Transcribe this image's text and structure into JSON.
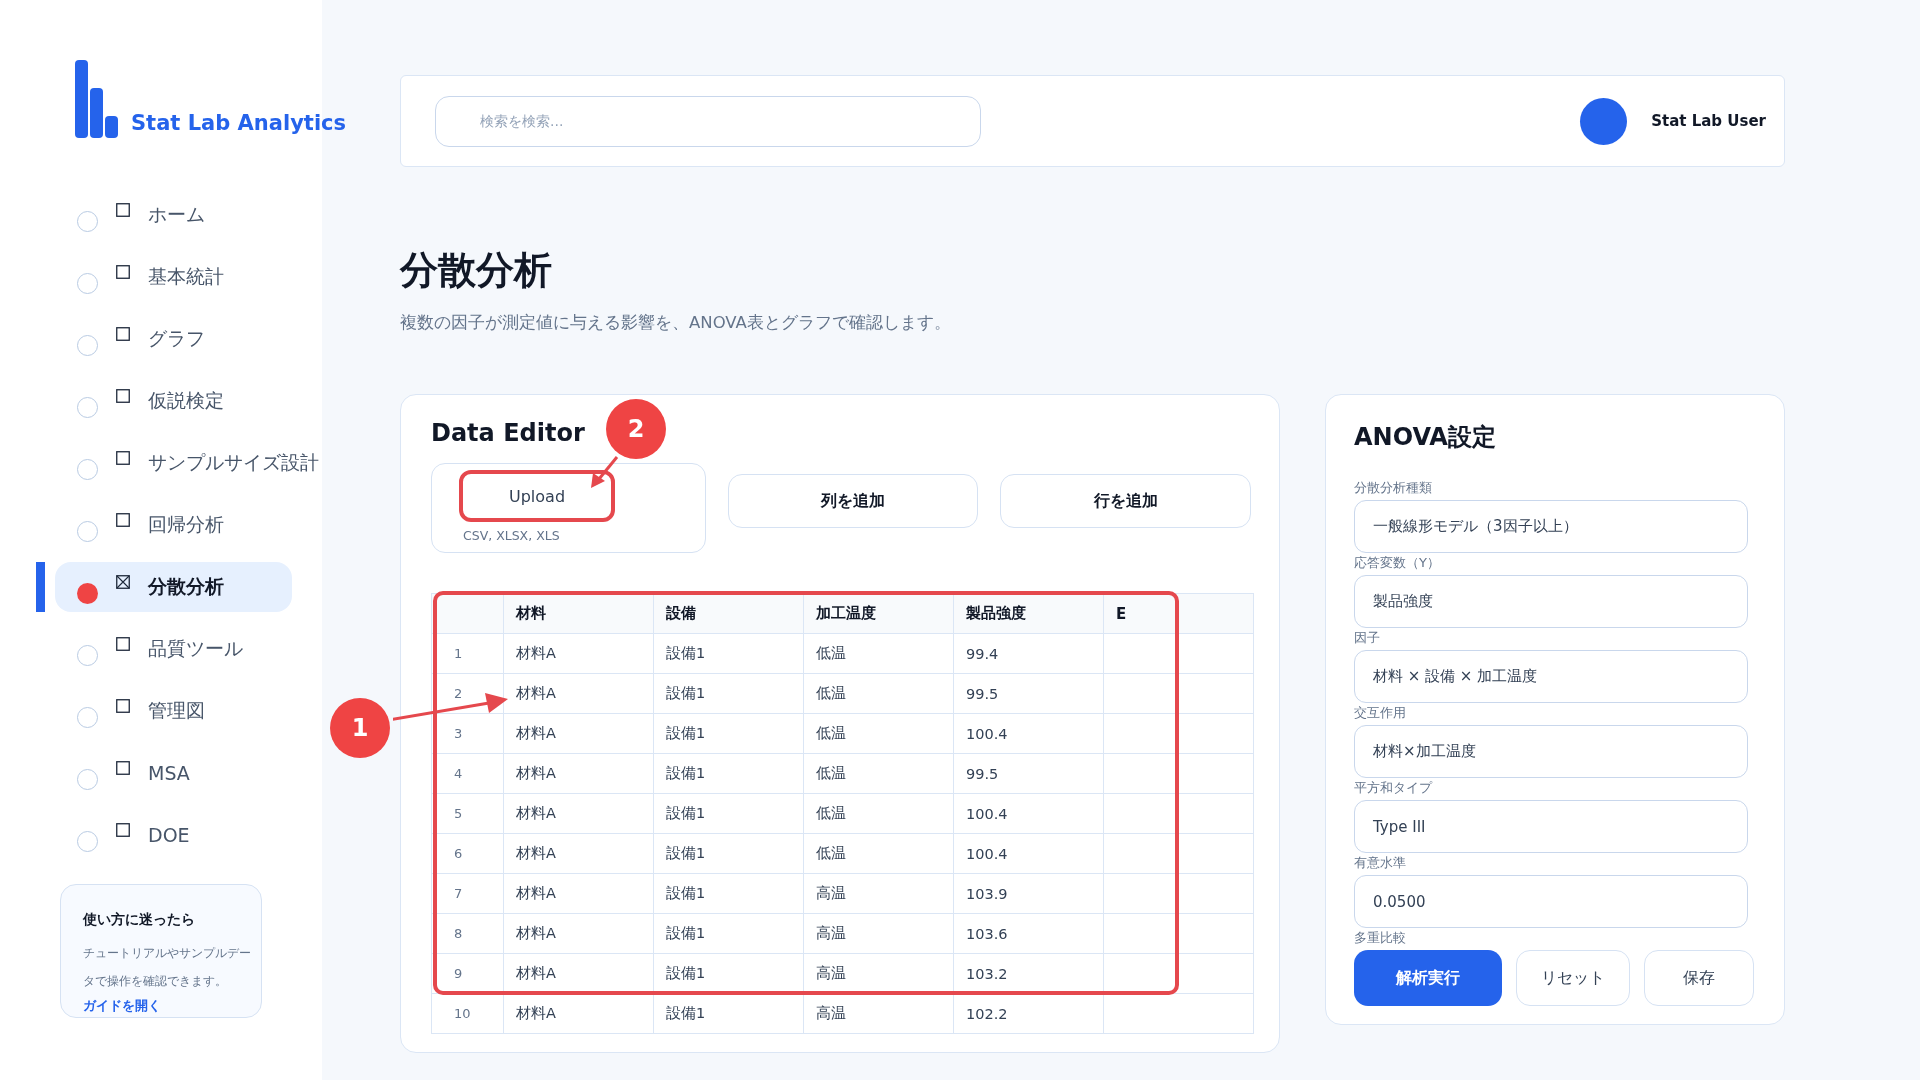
{
  "brand": {
    "name": "Stat Lab Analytics"
  },
  "sidebar": {
    "items": [
      {
        "label": "ホーム",
        "selected": false
      },
      {
        "label": "基本統計",
        "selected": false
      },
      {
        "label": "グラフ",
        "selected": false
      },
      {
        "label": "仮説検定",
        "selected": false
      },
      {
        "label": "サンプルサイズ設計",
        "selected": false
      },
      {
        "label": "回帰分析",
        "selected": false
      },
      {
        "label": "分散分析",
        "selected": true
      },
      {
        "label": "品質ツール",
        "selected": false
      },
      {
        "label": "管理図",
        "selected": false
      },
      {
        "label": "MSA",
        "selected": false
      },
      {
        "label": "DOE",
        "selected": false
      }
    ],
    "help": {
      "title": "使い方に迷ったら",
      "text": "チュートリアルやサンプルデータで操作を確認できます。",
      "link": "ガイドを開く"
    }
  },
  "header": {
    "search": {
      "placeholder": "検索を検索..."
    },
    "user": "Stat Lab User"
  },
  "page": {
    "title": "分散分析",
    "subtitle": "複数の因子が測定値に与える影響を、ANOVA表とグラフで確認します。"
  },
  "data_editor": {
    "title": "Data Editor",
    "upload": {
      "label": "Upload",
      "formats": "CSV, XLSX, XLS"
    },
    "buttons": [
      "列を追加",
      "行を追加"
    ],
    "table": {
      "columns": [
        "",
        "材料",
        "設備",
        "加工温度",
        "製品強度",
        "E"
      ],
      "rows": [
        [
          "1",
          "材料A",
          "設備1",
          "低温",
          "99.4",
          ""
        ],
        [
          "2",
          "材料A",
          "設備1",
          "低温",
          "99.5",
          ""
        ],
        [
          "3",
          "材料A",
          "設備1",
          "低温",
          "100.4",
          ""
        ],
        [
          "4",
          "材料A",
          "設備1",
          "低温",
          "99.5",
          ""
        ],
        [
          "5",
          "材料A",
          "設備1",
          "低温",
          "100.4",
          ""
        ],
        [
          "6",
          "材料A",
          "設備1",
          "低温",
          "100.4",
          ""
        ],
        [
          "7",
          "材料A",
          "設備1",
          "高温",
          "103.9",
          ""
        ],
        [
          "8",
          "材料A",
          "設備1",
          "高温",
          "103.6",
          ""
        ],
        [
          "9",
          "材料A",
          "設備1",
          "高温",
          "103.2",
          ""
        ],
        [
          "10",
          "材料A",
          "設備1",
          "高温",
          "102.2",
          ""
        ]
      ]
    }
  },
  "anova_settings": {
    "title": "ANOVA設定",
    "fields": [
      {
        "label": "分散分析種類",
        "value": "一般線形モデル（3因子以上）"
      },
      {
        "label": "応答変数（Y）",
        "value": "製品強度"
      },
      {
        "label": "因子",
        "value": "材料 × 設備 × 加工温度"
      },
      {
        "label": "交互作用",
        "value": "材料×加工温度"
      },
      {
        "label": "平方和タイプ",
        "value": "Type III"
      },
      {
        "label": "有意水準",
        "value": "0.0500"
      }
    ],
    "last_label": "多重比較",
    "buttons": [
      {
        "label": "解析実行",
        "kind": "primary"
      },
      {
        "label": "リセット",
        "kind": "secondary"
      },
      {
        "label": "保存",
        "kind": "secondary"
      }
    ]
  },
  "annotations": [
    {
      "label": "1",
      "kind": "table"
    },
    {
      "label": "2",
      "kind": "upload"
    }
  ]
}
